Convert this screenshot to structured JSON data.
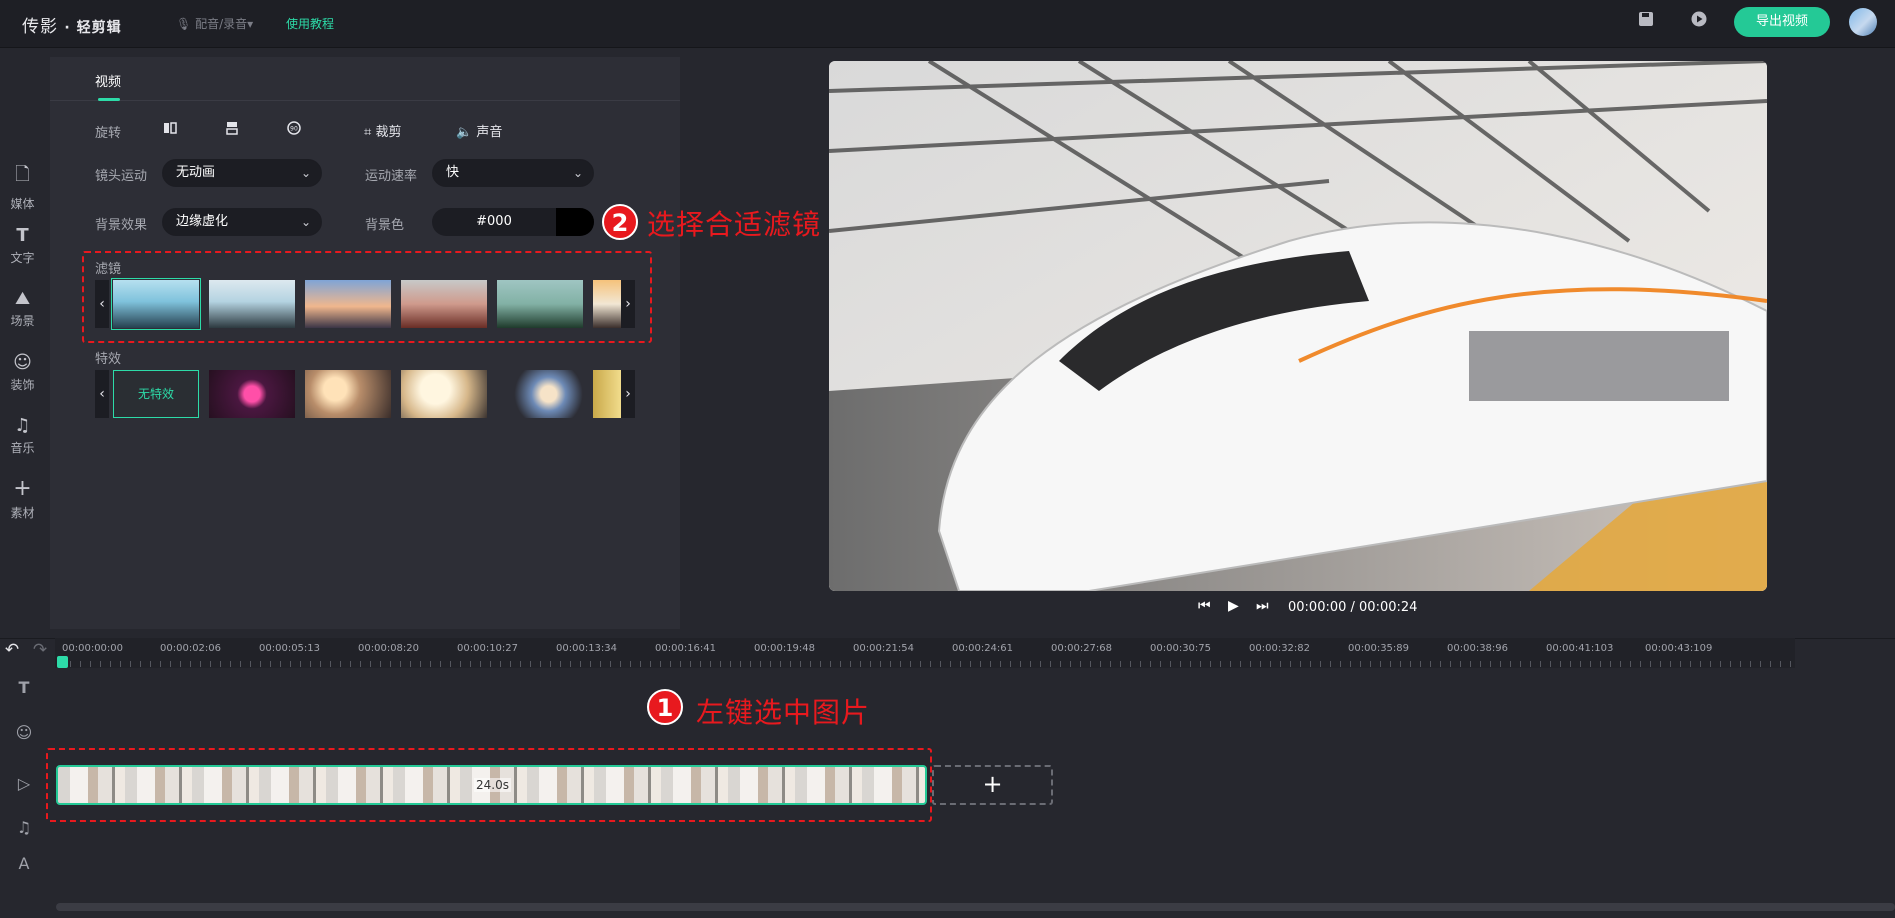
{
  "topbar": {
    "logo_main": "传影",
    "logo_sub": "· 轻剪辑",
    "voice_label": "配音/录音",
    "tutorial_label": "使用教程",
    "export_label": "导出视频",
    "icons": [
      "save-icon",
      "play-circle-icon",
      "avatar"
    ]
  },
  "nav": [
    {
      "label": "媒体",
      "icon": "file-icon"
    },
    {
      "label": "文字",
      "icon": "text-icon"
    },
    {
      "label": "场景",
      "icon": "mountain-icon"
    },
    {
      "label": "装饰",
      "icon": "smiley-icon"
    },
    {
      "label": "音乐",
      "icon": "music-icon"
    },
    {
      "label": "素材",
      "icon": "plus-icon"
    }
  ],
  "panel": {
    "tab": "视频",
    "rotate_label": "旋转",
    "crop_label": "裁剪",
    "sound_label": "声音",
    "camera_label": "镜头运动",
    "camera_value": "无动画",
    "speed_label": "运动速率",
    "speed_value": "快",
    "bg_effect_label": "背景效果",
    "bg_effect_value": "边缘虚化",
    "bg_color_label": "背景色",
    "bg_color_value": "#000",
    "filter_title": "滤镜",
    "fx_title": "特效",
    "fx_none": "无特效"
  },
  "callouts": {
    "one_num": "1",
    "one_text": "左键选中图片",
    "two_num": "2",
    "two_text": "选择合适滤镜"
  },
  "player": {
    "timecode": "00:00:00 / 00:00:24"
  },
  "timeline": {
    "ticks": [
      "00:00:00:00",
      "00:00:02:06",
      "00:00:05:13",
      "00:00:08:20",
      "00:00:10:27",
      "00:00:13:34",
      "00:00:16:41",
      "00:00:19:48",
      "00:00:21:54",
      "00:00:24:61",
      "00:00:27:68",
      "00:00:30:75",
      "00:00:32:82",
      "00:00:35:89",
      "00:00:38:96",
      "00:00:41:103",
      "00:00:43:109"
    ],
    "clip_duration": "24.0s",
    "add_label": "+"
  },
  "colors": {
    "accent": "#2ddba8",
    "callout": "#e8191e",
    "panel": "#2d2e36"
  }
}
